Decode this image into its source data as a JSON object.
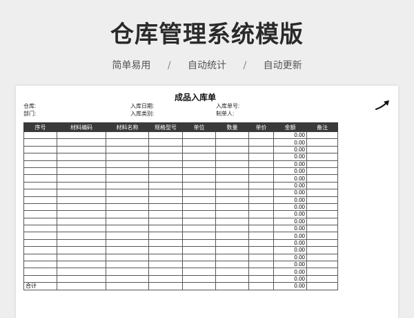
{
  "page": {
    "title": "仓库管理系统模版",
    "tags": [
      "简单易用",
      "自动统计",
      "自动更新"
    ],
    "separator": "/"
  },
  "doc": {
    "title": "成品入库单",
    "fields": {
      "warehouse": "仓库:",
      "department": "部门:",
      "entry_date": "入库日期:",
      "entry_type": "入库类别:",
      "entry_no": "入库单号:",
      "maker": "制单人:"
    },
    "columns": [
      "序号",
      "材料编码",
      "材料名称",
      "规格型号",
      "单位",
      "数量",
      "单价",
      "金额",
      "备注"
    ],
    "rows": [
      {
        "amount": "0.00"
      },
      {
        "amount": "0.00"
      },
      {
        "amount": "0.00"
      },
      {
        "amount": "0.00"
      },
      {
        "amount": "0.00"
      },
      {
        "amount": "0.00"
      },
      {
        "amount": "0.00"
      },
      {
        "amount": "0.00"
      },
      {
        "amount": "0.00"
      },
      {
        "amount": "0.00"
      },
      {
        "amount": "0.00"
      },
      {
        "amount": "0.00"
      },
      {
        "amount": "0.00"
      },
      {
        "amount": "0.00"
      },
      {
        "amount": "0.00"
      },
      {
        "amount": "0.00"
      },
      {
        "amount": "0.00"
      },
      {
        "amount": "0.00"
      },
      {
        "amount": "0.00"
      },
      {
        "amount": "0.00"
      },
      {
        "amount": "0.00"
      }
    ],
    "total": {
      "label": "合计",
      "amount": "0.00"
    }
  },
  "icons": {
    "arrow": "arrow-up-right-icon"
  }
}
